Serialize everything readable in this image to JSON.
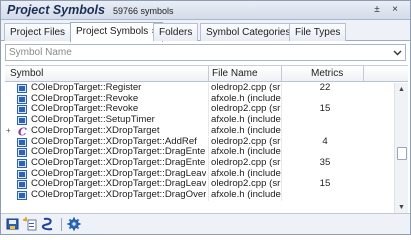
{
  "header": {
    "title": "Project Symbols",
    "symbol_count": "59766 symbols",
    "pin_glyph": "±",
    "close_glyph": "×"
  },
  "tabs": [
    {
      "label": "Project Files",
      "active": false
    },
    {
      "label": "Project Symbols",
      "active": true,
      "close_glyph": "×"
    },
    {
      "label": "Folders",
      "active": false
    },
    {
      "label": "Symbol Categories",
      "active": false
    },
    {
      "label": "File Types",
      "active": false
    }
  ],
  "search": {
    "placeholder": "Symbol Name",
    "value": "",
    "dropdown_icon": "chevron-down-icon"
  },
  "columns": {
    "symbol": "Symbol",
    "file_name": "File Name",
    "metrics": "Metrics"
  },
  "rows": [
    {
      "icon": "method-icon",
      "symbol": "COleDropTarget::Register",
      "file": "oledrop2.cpp (sr",
      "metrics": "22",
      "expandable": false
    },
    {
      "icon": "method-icon",
      "symbol": "COleDropTarget::Revoke",
      "file": "afxole.h (include",
      "metrics": "",
      "expandable": false
    },
    {
      "icon": "method-icon",
      "symbol": "COleDropTarget::Revoke",
      "file": "oledrop2.cpp (sr",
      "metrics": "15",
      "expandable": false
    },
    {
      "icon": "method-icon",
      "symbol": "COleDropTarget::SetupTimer",
      "file": "afxole.h (include",
      "metrics": "",
      "expandable": false
    },
    {
      "icon": "class-icon",
      "symbol": "COleDropTarget::XDropTarget",
      "file": "afxole.h (include",
      "metrics": "",
      "expandable": true
    },
    {
      "icon": "method-icon",
      "symbol": "COleDropTarget::XDropTarget::AddRef",
      "file": "oledrop2.cpp (sr",
      "metrics": "4",
      "expandable": false
    },
    {
      "icon": "method-icon",
      "symbol": "COleDropTarget::XDropTarget::DragEnter",
      "file": "afxole.h (include",
      "metrics": "",
      "expandable": false
    },
    {
      "icon": "method-icon",
      "symbol": "COleDropTarget::XDropTarget::DragEnter",
      "file": "oledrop2.cpp (sr",
      "metrics": "35",
      "expandable": false
    },
    {
      "icon": "method-icon",
      "symbol": "COleDropTarget::XDropTarget::DragLeave",
      "file": "afxole.h (include",
      "metrics": "",
      "expandable": false
    },
    {
      "icon": "method-icon",
      "symbol": "COleDropTarget::XDropTarget::DragLeave",
      "file": "oledrop2.cpp (sr",
      "metrics": "15",
      "expandable": false
    },
    {
      "icon": "method-icon",
      "symbol": "COleDropTarget::XDropTarget::DragOver",
      "file": "afxole.h (include",
      "metrics": "",
      "expandable": false
    }
  ],
  "scrollbar": {
    "position_fraction": 0.56
  },
  "toolbar": [
    {
      "icon": "save-symbols-icon"
    },
    {
      "icon": "new-symbol-icon"
    },
    {
      "icon": "rename-symbol-icon"
    },
    {
      "icon": "settings-gear-icon"
    }
  ],
  "colors": {
    "accent": "#1b2f56",
    "method_icon": "#2b63b8",
    "class_icon": "#8b2fa8"
  }
}
